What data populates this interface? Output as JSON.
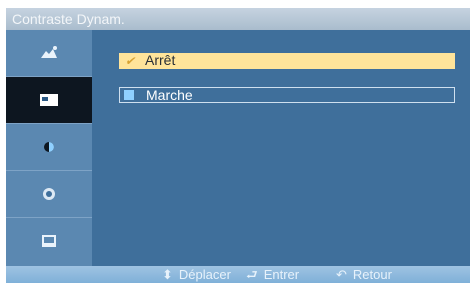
{
  "title": "Contraste Dynam.",
  "sidebar": {
    "items": [
      {
        "icon": "picture-icon",
        "selected": false
      },
      {
        "icon": "screen-icon",
        "selected": true
      },
      {
        "icon": "sound-icon",
        "selected": false
      },
      {
        "icon": "settings-icon",
        "selected": false
      },
      {
        "icon": "multi-control-icon",
        "selected": false
      }
    ]
  },
  "options": [
    {
      "label": "Arrêt",
      "selected": true
    },
    {
      "label": "Marche",
      "selected": false
    }
  ],
  "footer": {
    "move_label": "Déplacer",
    "enter_label": "Entrer",
    "return_label": "Retour"
  },
  "colors": {
    "panel": "#3f6f9b",
    "sidebar": "#5b88b1",
    "highlight": "#ffe49a",
    "selected_tab": "#0d1620"
  }
}
